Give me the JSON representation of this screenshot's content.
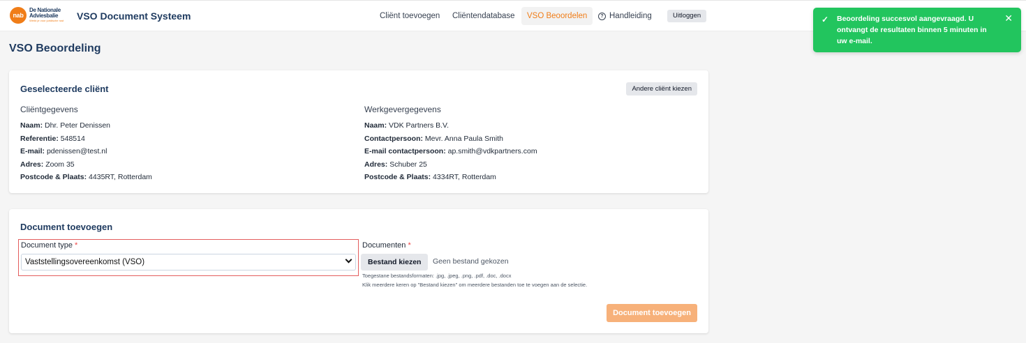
{
  "header": {
    "logo": {
      "mark": "nab",
      "line1": "De Nationale",
      "line2": "Adviesbalie",
      "tagline": "Werkt je voor juridische rust"
    },
    "app_title": "VSO Document Systeem",
    "nav": [
      "Cliënt toevoegen",
      "Cliëntendatabase",
      "VSO Beoordelen",
      "Handleiding"
    ],
    "active_nav": "VSO Beoordelen",
    "logout_label": "Uitloggen"
  },
  "toast": {
    "message": "Beoordeling succesvol aangevraagd. U ontvangt de resultaten binnen 5 minuten in uw e-mail.",
    "icon": "check-icon",
    "close_icon": "close-icon"
  },
  "page_title": "VSO Beoordeling",
  "client_card": {
    "title": "Geselecteerde cliënt",
    "change_button": "Andere cliënt kiezen",
    "client": {
      "heading": "Cliëntgegevens",
      "rows": [
        {
          "label": "Naam:",
          "value": "Dhr. Peter Denissen"
        },
        {
          "label": "Referentie:",
          "value": "548514"
        },
        {
          "label": "E-mail:",
          "value": "pdenissen@test.nl"
        },
        {
          "label": "Adres:",
          "value": "Zoom 35"
        },
        {
          "label": "Postcode & Plaats:",
          "value": "4435RT, Rotterdam"
        }
      ]
    },
    "employer": {
      "heading": "Werkgevergegevens",
      "rows": [
        {
          "label": "Naam:",
          "value": "VDK Partners B.V."
        },
        {
          "label": "Contactpersoon:",
          "value": "Mevr. Anna Paula Smith"
        },
        {
          "label": "E-mail contactpersoon:",
          "value": "ap.smith@vdkpartners.com"
        },
        {
          "label": "Adres:",
          "value": "Schuber 25"
        },
        {
          "label": "Postcode & Plaats:",
          "value": "4334RT, Rotterdam"
        }
      ]
    }
  },
  "document_card": {
    "title": "Document toevoegen",
    "type_label": "Document type",
    "type_value": "Vaststellingsovereenkomst (VSO)",
    "docs_label": "Documenten",
    "required_mark": "*",
    "file_button": "Bestand kiezen",
    "file_status": "Geen bestand gekozen",
    "hint1": "Toegestane bestandsformaten: .jpg, .jpeg, .png, .pdf, .doc, .docx",
    "hint2": "Klik meerdere keren op \"Bestand kiezen\" om meerdere bestanden toe te voegen aan de selectie.",
    "submit_button": "Document toevoegen"
  },
  "colors": {
    "accent": "#f07d18",
    "primary": "#1e3a5f",
    "success": "#22c55e",
    "submit": "#f7b17a"
  }
}
